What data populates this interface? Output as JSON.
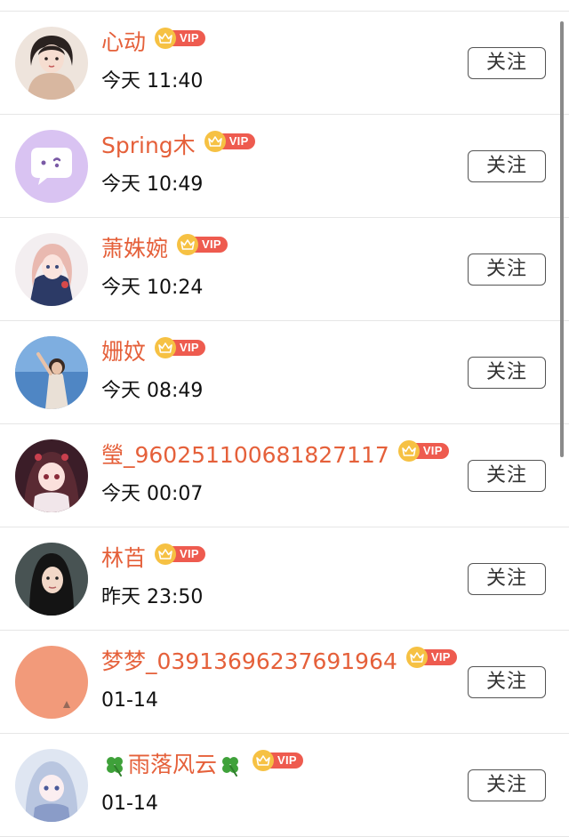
{
  "follow_label": "关注",
  "vip_label": "VIP",
  "colors": {
    "username": "#e5603a",
    "vip_crown": "#f6c143",
    "vip_tag": "#ee5b4f"
  },
  "users": [
    {
      "name": "心动",
      "time": "今天 11:40",
      "avatar": "girl-illustration-avatar"
    },
    {
      "name": "Spring木",
      "time": "今天 10:49",
      "avatar": "chat-bubble-default-avatar"
    },
    {
      "name": "萧姝婉",
      "time": "今天 10:24",
      "avatar": "anime-girl-avatar"
    },
    {
      "name": "姗妏",
      "time": "今天 08:49",
      "avatar": "photo-girl-sky-avatar"
    },
    {
      "name": "瑩_960251100681827117",
      "time": "今天 00:07",
      "avatar": "anime-girl-red-avatar"
    },
    {
      "name": "林苩",
      "time": "昨天 23:50",
      "avatar": "photo-girl-dark-avatar"
    },
    {
      "name": "梦梦_03913696237691964",
      "time": "01-14",
      "avatar": "peach-placeholder-avatar"
    },
    {
      "name": "雨落风云",
      "time": "01-14",
      "avatar": "anime-girl-blue-avatar",
      "clover_icons": true
    }
  ]
}
